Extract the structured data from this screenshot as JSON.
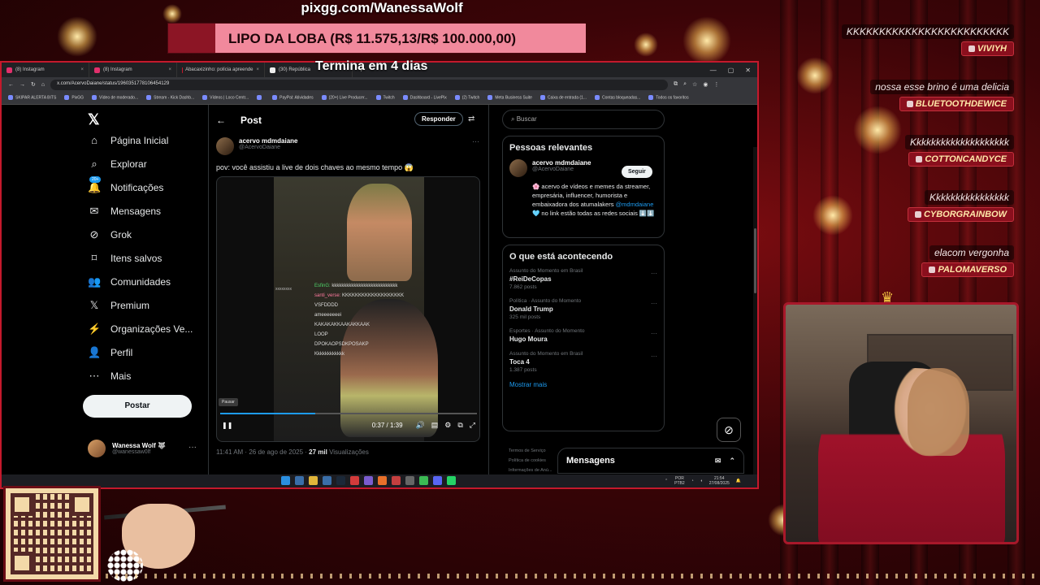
{
  "overlay": {
    "url": "pixgg.com/WanessaWolf",
    "goal_text": "LIPO DA LOBA (R$ 11.575,13/R$ 100.000,00)",
    "countdown": "Termina em 4 dias",
    "goal_progress_fraction": 0.1158
  },
  "browser": {
    "tabs": [
      "(8) Instagram",
      "(8) Instagram",
      "Abacaxizinho: polícia apreende",
      "(30) República"
    ],
    "new_tab": "+",
    "address": "x.com/AcervoDaiane/status/1960351778106454129",
    "bookmarks": [
      "SKIPAR ALERTA BITS",
      "PixGG",
      "Vídeo de moderado...",
      "Stream - Kick Dashb...",
      "Vídeos | Loco Centr...",
      "",
      "PayPal: Atividades",
      "(20+) Live Producer...",
      "Twitch",
      "Dashboard - LivePix",
      "(2) Twitch",
      "Meta Business Suite",
      "Caixa de entrada (1...",
      "Contas bloqueadas...",
      "Todos os favoritos"
    ]
  },
  "x_nav": {
    "logo": "𝕏",
    "items": [
      {
        "label": "Página Inicial",
        "icon": "⌂"
      },
      {
        "label": "Explorar",
        "icon": "⌕"
      },
      {
        "label": "Notificações",
        "icon": "🔔"
      },
      {
        "label": "Mensagens",
        "icon": "✉"
      },
      {
        "label": "Grok",
        "icon": "⊘"
      },
      {
        "label": "Itens salvos",
        "icon": "⌑"
      },
      {
        "label": "Comunidades",
        "icon": "👥"
      },
      {
        "label": "Premium",
        "icon": "𝕏"
      },
      {
        "label": "Organizações Ve...",
        "icon": "⚡"
      },
      {
        "label": "Perfil",
        "icon": "👤"
      },
      {
        "label": "Mais",
        "icon": "⋯"
      }
    ],
    "notif_badge": "20+",
    "post_button": "Postar",
    "account_name": "Wanessa Wolf 🐺",
    "account_handle": "@wanessaw0lf",
    "account_more": "···"
  },
  "post": {
    "header": "Post",
    "back": "←",
    "reply_button": "Responder",
    "author_name": "acervo mdmdaiane",
    "author_handle": "@AcervoDaiane",
    "menu": "···",
    "text": "pov: você assistiu a live de dois chaves ao mesmo tempo 😱",
    "video_chat": [
      {
        "user": "EsfinG:",
        "msg": "kkkkkkkkkkkkkkkkkkkkkkkkkkk"
      },
      {
        "user": "santi_verse:",
        "msg": "KKKKKKKKKKKKKKKKKKK"
      },
      {
        "user": "",
        "msg": "VSFDDDD"
      },
      {
        "user": "",
        "msg": "ameeeeeeei"
      },
      {
        "user": "",
        "msg": "KAKAKAKKAAKAKKAAK"
      },
      {
        "user": "",
        "msg": "LOOP"
      },
      {
        "user": "",
        "msg": "DPOKAOPSDKPOSAKP"
      },
      {
        "user": "",
        "msg": "Kkkkkkkkkkkk"
      }
    ],
    "video_left_text": "xxxxxxxx",
    "pause_tooltip": "Pausar",
    "time": "0:37 / 1:39",
    "progress_fraction": 0.37,
    "timestamp": "11:41 AM · 26 de ago de 2025 · ",
    "views": "27 mil",
    "views_label": " Visualizações"
  },
  "sidebar": {
    "search_placeholder": "Buscar",
    "relevant_title": "Pessoas relevantes",
    "rel_name": "acervo mdmdaiane",
    "rel_handle": "@AcervoDaiane",
    "follow": "Seguir",
    "bio": "🌸 acervo de vídeos e memes da streamer, empresária, influencer, humorista e embaixadora dos atumalakers ",
    "bio_link": "@mdmdaiane",
    "bio_end": " 🩵 no link estão todas as redes sociais ⬇️⬇️",
    "trending_title": "O que está acontecendo",
    "trends": [
      {
        "ctx": "Assunto do Momento em Brasil",
        "title": "#ReiDeCopas",
        "count": "7.862 posts"
      },
      {
        "ctx": "Política · Assunto do Momento",
        "title": "Donald Trump",
        "count": "325 mil posts"
      },
      {
        "ctx": "Esportes · Assunto do Momento",
        "title": "Hugo Moura",
        "count": ""
      },
      {
        "ctx": "Assunto do Momento em Brasil",
        "title": "Toca 4",
        "count": "1.387 posts"
      }
    ],
    "show_more": "Mostrar mais",
    "footer": [
      "Termos de Serviço",
      "Política de cookies",
      "Informações de Anú..."
    ]
  },
  "messages_dock": {
    "title": "Mensagens"
  },
  "taskbar": {
    "lang1": "POR",
    "lang2": "PTB2",
    "time": "21:54",
    "date": "27/08/2025"
  },
  "stream_chat": [
    {
      "msg": "KKKKKKKKKKKKKKKKKKKKKKKKK",
      "user": "VIVIYH"
    },
    {
      "msg": "nossa esse brino é uma delicia",
      "user": "BLUETOOTHDEWICE"
    },
    {
      "msg": "Kkkkkkkkkkkkkkkkkkkk",
      "user": "COTTONCANDYCE"
    },
    {
      "msg": "Kkkkkkkkkkkkkkkk",
      "user": "CYBORGRAINBOW"
    },
    {
      "msg": "elacom vergonha",
      "user": "PALOMAVERSO"
    }
  ],
  "colors": {
    "accent": "#1d9bf0",
    "overlay_red": "#8a0f1d",
    "goal_fill": "#f1899c"
  }
}
